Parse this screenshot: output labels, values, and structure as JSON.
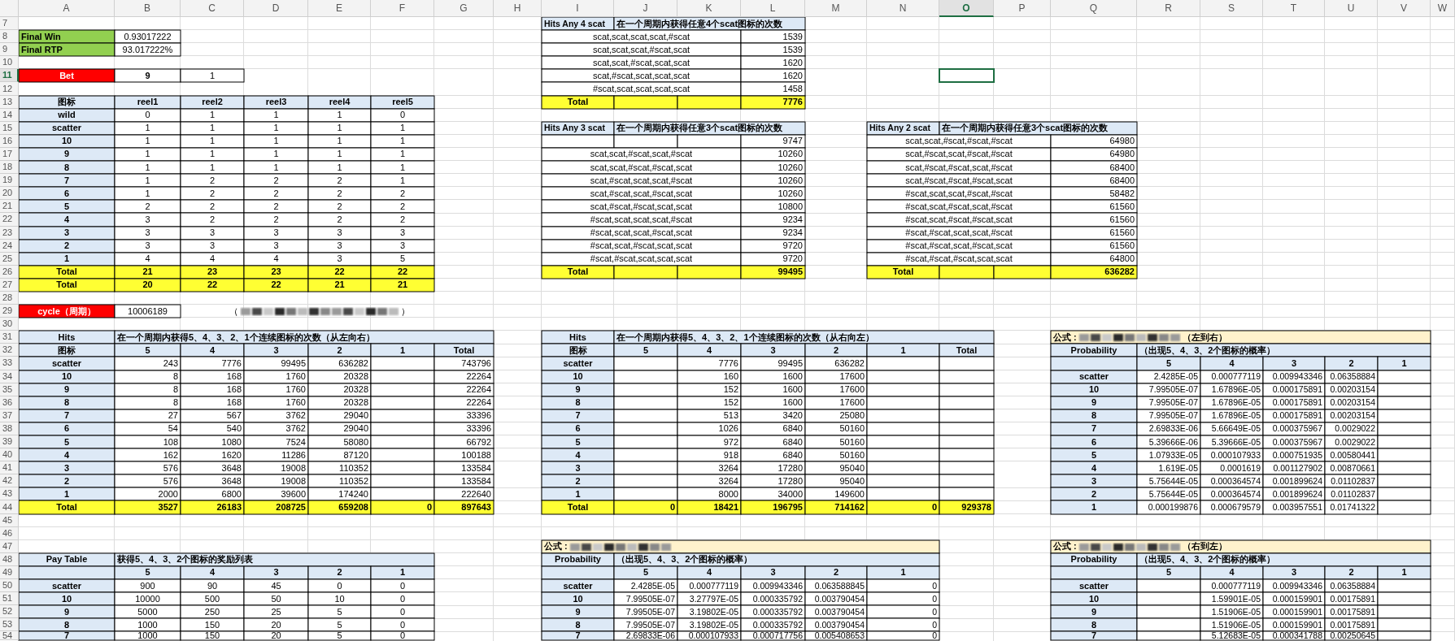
{
  "columns": [
    {
      "label": "A",
      "selected": false
    },
    {
      "label": "B",
      "selected": false
    },
    {
      "label": "C",
      "selected": false
    },
    {
      "label": "D",
      "selected": false
    },
    {
      "label": "E",
      "selected": false
    },
    {
      "label": "F",
      "selected": false
    },
    {
      "label": "G",
      "selected": false
    },
    {
      "label": "H",
      "selected": false
    },
    {
      "label": "I",
      "selected": false
    },
    {
      "label": "J",
      "selected": false
    },
    {
      "label": "K",
      "selected": false
    },
    {
      "label": "L",
      "selected": false
    },
    {
      "label": "M",
      "selected": false
    },
    {
      "label": "N",
      "selected": false
    },
    {
      "label": "O",
      "selected": true
    },
    {
      "label": "P",
      "selected": false
    },
    {
      "label": "Q",
      "selected": false
    },
    {
      "label": "R",
      "selected": false
    },
    {
      "label": "S",
      "selected": false
    },
    {
      "label": "T",
      "selected": false
    },
    {
      "label": "U",
      "selected": false
    },
    {
      "label": "V",
      "selected": false
    },
    {
      "label": "W",
      "selected": false
    }
  ],
  "rows": [
    {
      "label": "7",
      "selected": false
    },
    {
      "label": "8",
      "selected": false
    },
    {
      "label": "9",
      "selected": false
    },
    {
      "label": "10",
      "selected": false
    },
    {
      "label": "11",
      "selected": true
    },
    {
      "label": "12",
      "selected": false
    },
    {
      "label": "13",
      "selected": false
    },
    {
      "label": "14",
      "selected": false
    },
    {
      "label": "15",
      "selected": false
    },
    {
      "label": "16",
      "selected": false
    },
    {
      "label": "17",
      "selected": false
    },
    {
      "label": "18",
      "selected": false
    },
    {
      "label": "19",
      "selected": false
    },
    {
      "label": "20",
      "selected": false
    },
    {
      "label": "21",
      "selected": false
    },
    {
      "label": "22",
      "selected": false
    },
    {
      "label": "23",
      "selected": false
    },
    {
      "label": "24",
      "selected": false
    },
    {
      "label": "25",
      "selected": false
    },
    {
      "label": "26",
      "selected": false
    },
    {
      "label": "27",
      "selected": false
    },
    {
      "label": "28",
      "selected": false
    },
    {
      "label": "29",
      "selected": false
    },
    {
      "label": "30",
      "selected": false
    },
    {
      "label": "31",
      "selected": false
    },
    {
      "label": "32",
      "selected": false
    },
    {
      "label": "33",
      "selected": false
    },
    {
      "label": "34",
      "selected": false
    },
    {
      "label": "35",
      "selected": false
    },
    {
      "label": "36",
      "selected": false
    },
    {
      "label": "37",
      "selected": false
    },
    {
      "label": "38",
      "selected": false
    },
    {
      "label": "39",
      "selected": false
    },
    {
      "label": "40",
      "selected": false
    },
    {
      "label": "41",
      "selected": false
    },
    {
      "label": "42",
      "selected": false
    },
    {
      "label": "43",
      "selected": false
    },
    {
      "label": "44",
      "selected": false
    },
    {
      "label": "45",
      "selected": false
    },
    {
      "label": "46",
      "selected": false
    },
    {
      "label": "47",
      "selected": false
    },
    {
      "label": "48",
      "selected": false
    },
    {
      "label": "49",
      "selected": false
    },
    {
      "label": "50",
      "selected": false
    },
    {
      "label": "51",
      "selected": false
    },
    {
      "label": "52",
      "selected": false
    },
    {
      "label": "53",
      "selected": false
    },
    {
      "label": "54",
      "selected": false
    }
  ],
  "summary": [
    {
      "label": "Final Win",
      "value": "0.93017222"
    },
    {
      "label": "Final RTP",
      "value": "93.017222%"
    }
  ],
  "bet": {
    "label": "Bet",
    "values": [
      "9",
      "1"
    ]
  },
  "reel_table": {
    "header": [
      "图标",
      "reel1",
      "reel2",
      "reel3",
      "reel4",
      "reel5"
    ],
    "rows": [
      [
        "wild",
        "0",
        "1",
        "1",
        "1",
        "0"
      ],
      [
        "scatter",
        "1",
        "1",
        "1",
        "1",
        "1"
      ],
      [
        "10",
        "1",
        "1",
        "1",
        "1",
        "1"
      ],
      [
        "9",
        "1",
        "1",
        "1",
        "1",
        "1"
      ],
      [
        "8",
        "1",
        "1",
        "1",
        "1",
        "1"
      ],
      [
        "7",
        "1",
        "2",
        "2",
        "2",
        "1"
      ],
      [
        "6",
        "1",
        "2",
        "2",
        "2",
        "2"
      ],
      [
        "5",
        "2",
        "2",
        "2",
        "2",
        "2"
      ],
      [
        "4",
        "3",
        "2",
        "2",
        "2",
        "2"
      ],
      [
        "3",
        "3",
        "3",
        "3",
        "3",
        "3"
      ],
      [
        "2",
        "3",
        "3",
        "3",
        "3",
        "3"
      ],
      [
        "1",
        "4",
        "4",
        "4",
        "3",
        "5"
      ]
    ],
    "totals": [
      [
        "Total",
        "21",
        "23",
        "23",
        "22",
        "22"
      ],
      [
        "Total",
        "20",
        "22",
        "22",
        "21",
        "21"
      ]
    ]
  },
  "cycle": {
    "label": "cycle（周期）",
    "value": "10006189",
    "note_open": "（",
    "note_close": "）"
  },
  "hits_left_to_right": {
    "label": "Hits",
    "title": "在一个周期内获得5、4、3、2、1个连续图标的次数（从左向右）",
    "header": [
      "图标",
      "5",
      "4",
      "3",
      "2",
      "1",
      "Total"
    ],
    "rows": [
      [
        "scatter",
        "243",
        "7776",
        "99495",
        "636282",
        null,
        "743796"
      ],
      [
        "10",
        "8",
        "168",
        "1760",
        "20328",
        null,
        "22264"
      ],
      [
        "9",
        "8",
        "168",
        "1760",
        "20328",
        null,
        "22264"
      ],
      [
        "8",
        "8",
        "168",
        "1760",
        "20328",
        null,
        "22264"
      ],
      [
        "7",
        "27",
        "567",
        "3762",
        "29040",
        null,
        "33396"
      ],
      [
        "6",
        "54",
        "540",
        "3762",
        "29040",
        null,
        "33396"
      ],
      [
        "5",
        "108",
        "1080",
        "7524",
        "58080",
        null,
        "66792"
      ],
      [
        "4",
        "162",
        "1620",
        "11286",
        "87120",
        null,
        "100188"
      ],
      [
        "3",
        "576",
        "3648",
        "19008",
        "110352",
        null,
        "133584"
      ],
      [
        "2",
        "576",
        "3648",
        "19008",
        "110352",
        null,
        "133584"
      ],
      [
        "1",
        "2000",
        "6800",
        "39600",
        "174240",
        null,
        "222640"
      ]
    ],
    "total": [
      "Total",
      "3527",
      "26183",
      "208725",
      "659208",
      "0",
      "897643"
    ]
  },
  "pay_table": {
    "label": "Pay Table",
    "title": "获得5、4、3、2个图标的奖励列表",
    "header": [
      "5",
      "4",
      "3",
      "2",
      "1"
    ],
    "rows": [
      [
        "scatter",
        "900",
        "90",
        "45",
        "0",
        "0"
      ],
      [
        "10",
        "10000",
        "500",
        "50",
        "10",
        "0"
      ],
      [
        "9",
        "5000",
        "250",
        "25",
        "5",
        "0"
      ],
      [
        "8",
        "1000",
        "150",
        "20",
        "5",
        "0"
      ],
      [
        "7",
        "1000",
        "150",
        "20",
        "5",
        "0"
      ]
    ]
  },
  "hits_any_4": {
    "label": "Hits Any 4 scat",
    "title": "在一个周期内获得任意4个scat图标的次数",
    "rows": [
      {
        "combo": "scat,scat,scat,scat,#scat",
        "count": "1539"
      },
      {
        "combo": "scat,scat,scat,#scat,scat",
        "count": "1539"
      },
      {
        "combo": "scat,scat,#scat,scat,scat",
        "count": "1620"
      },
      {
        "combo": "scat,#scat,scat,scat,scat",
        "count": "1620"
      },
      {
        "combo": "#scat,scat,scat,scat,scat",
        "count": "1458"
      }
    ],
    "total": {
      "label": "Total",
      "count": "7776"
    }
  },
  "hits_any_3": {
    "label": "Hits Any 3 scat",
    "title": "在一个周期内获得任意3个scat图标的次数",
    "rows": [
      {
        "count": "9747"
      },
      {
        "combo": "scat,scat,#scat,scat,#scat",
        "count": "10260"
      },
      {
        "combo": "scat,scat,#scat,#scat,scat",
        "count": "10260"
      },
      {
        "combo": "scat,#scat,scat,scat,#scat",
        "count": "10260"
      },
      {
        "combo": "scat,#scat,scat,#scat,scat",
        "count": "10260"
      },
      {
        "combo": "scat,#scat,#scat,scat,scat",
        "count": "10800"
      },
      {
        "combo": "#scat,scat,scat,scat,#scat",
        "count": "9234"
      },
      {
        "combo": "#scat,scat,scat,#scat,scat",
        "count": "9234"
      },
      {
        "combo": "#scat,scat,#scat,scat,scat",
        "count": "9720"
      },
      {
        "combo": "#scat,#scat,scat,scat,scat",
        "count": "9720"
      }
    ],
    "total": {
      "label": "Total",
      "count": "99495"
    }
  },
  "hits_any_2": {
    "label": "Hits Any 2 scat",
    "title": "在一个周期内获得任意3个scat图标的次数",
    "rows": [
      {
        "combo": "scat,scat,#scat,#scat,#scat",
        "count": "64980"
      },
      {
        "combo": "scat,#scat,scat,#scat,#scat",
        "count": "64980"
      },
      {
        "combo": "scat,#scat,#scat,scat,#scat",
        "count": "68400"
      },
      {
        "combo": "scat,#scat,#scat,#scat,scat",
        "count": "68400"
      },
      {
        "combo": "#scat,scat,scat,#scat,#scat",
        "count": "58482"
      },
      {
        "combo": "#scat,scat,#scat,scat,#scat",
        "count": "61560"
      },
      {
        "combo": "#scat,scat,#scat,#scat,scat",
        "count": "61560"
      },
      {
        "combo": "#scat,#scat,scat,scat,#scat",
        "count": "61560"
      },
      {
        "combo": "#scat,#scat,scat,#scat,scat",
        "count": "61560"
      },
      {
        "combo": "#scat,#scat,#scat,scat,scat",
        "count": "64800"
      }
    ],
    "total": {
      "label": "Total",
      "count": "636282"
    }
  },
  "hits_right_to_left": {
    "label": "Hits",
    "title": "在一个周期内获得5、4、3、2、1个连续图标的次数（从右向左）",
    "header": [
      "图标",
      "5",
      "4",
      "3",
      "2",
      "1",
      "Total"
    ],
    "rows": [
      [
        "scatter",
        null,
        "7776",
        "99495",
        "636282",
        null,
        null
      ],
      [
        "10",
        null,
        "160",
        "1600",
        "17600",
        null,
        null
      ],
      [
        "9",
        null,
        "152",
        "1600",
        "17600",
        null,
        null
      ],
      [
        "8",
        null,
        "152",
        "1600",
        "17600",
        null,
        null
      ],
      [
        "7",
        null,
        "513",
        "3420",
        "25080",
        null,
        null
      ],
      [
        "6",
        null,
        "1026",
        "6840",
        "50160",
        null,
        null
      ],
      [
        "5",
        null,
        "972",
        "6840",
        "50160",
        null,
        null
      ],
      [
        "4",
        null,
        "918",
        "6840",
        "50160",
        null,
        null
      ],
      [
        "3",
        null,
        "3264",
        "17280",
        "95040",
        null,
        null
      ],
      [
        "2",
        null,
        "3264",
        "17280",
        "95040",
        null,
        null
      ],
      [
        "1",
        null,
        "8000",
        "34000",
        "149600",
        null,
        null
      ]
    ],
    "total": [
      "Total",
      "0",
      "18421",
      "196795",
      "714162",
      "0",
      "929378"
    ]
  },
  "probability_left_to_right": {
    "formula_label": "公式 :",
    "direction": "（左到右）",
    "label": "Probability",
    "title": "（出现5、4、3、2个图标的概率）",
    "header": [
      "5",
      "4",
      "3",
      "2",
      "1"
    ],
    "rows": [
      [
        "scatter",
        "2.4285E-05",
        "0.000777119",
        "0.009943346",
        "0.06358884",
        null
      ],
      [
        "10",
        "7.99505E-07",
        "1.67896E-05",
        "0.000175891",
        "0.00203154",
        null
      ],
      [
        "9",
        "7.99505E-07",
        "1.67896E-05",
        "0.000175891",
        "0.00203154",
        null
      ],
      [
        "8",
        "7.99505E-07",
        "1.67896E-05",
        "0.000175891",
        "0.00203154",
        null
      ],
      [
        "7",
        "2.69833E-06",
        "5.66649E-05",
        "0.000375967",
        "0.0029022",
        null
      ],
      [
        "6",
        "5.39666E-06",
        "5.39666E-05",
        "0.000375967",
        "0.0029022",
        null
      ],
      [
        "5",
        "1.07933E-05",
        "0.000107933",
        "0.000751935",
        "0.00580441",
        null
      ],
      [
        "4",
        "1.619E-05",
        "0.0001619",
        "0.001127902",
        "0.00870661",
        null
      ],
      [
        "3",
        "5.75644E-05",
        "0.000364574",
        "0.001899624",
        "0.01102837",
        null
      ],
      [
        "2",
        "5.75644E-05",
        "0.000364574",
        "0.001899624",
        "0.01102837",
        null
      ],
      [
        "1",
        "0.000199876",
        "0.000679579",
        "0.003957551",
        "0.01741322",
        null
      ]
    ]
  },
  "probability_middle": {
    "formula_label": "公式 :",
    "label": "Probability",
    "title": "（出现5、4、3、2个图标的概率）",
    "header": [
      "5",
      "4",
      "3",
      "2",
      "1"
    ],
    "rows": [
      [
        "scatter",
        "2.4285E-05",
        "0.000777119",
        "0.009943346",
        "0.063588845",
        "0"
      ],
      [
        "10",
        "7.99505E-07",
        "3.27797E-05",
        "0.000335792",
        "0.003790454",
        "0"
      ],
      [
        "9",
        "7.99505E-07",
        "3.19802E-05",
        "0.000335792",
        "0.003790454",
        "0"
      ],
      [
        "8",
        "7.99505E-07",
        "3.19802E-05",
        "0.000335792",
        "0.003790454",
        "0"
      ],
      [
        "7",
        "2.69833E-06",
        "0.000107933",
        "0.000717756",
        "0.005408653",
        "0"
      ]
    ]
  },
  "probability_right_to_left": {
    "formula_label": "公式 :",
    "direction": "（右到左）",
    "label": "Probability",
    "title": "（出现5、4、3、2个图标的概率）",
    "header": [
      "5",
      "4",
      "3",
      "2",
      "1"
    ],
    "rows": [
      [
        "scatter",
        null,
        "0.000777119",
        "0.009943346",
        "0.06358884",
        null
      ],
      [
        "10",
        null,
        "1.59901E-05",
        "0.000159901",
        "0.00175891",
        null
      ],
      [
        "9",
        null,
        "1.51906E-05",
        "0.000159901",
        "0.00175891",
        null
      ],
      [
        "8",
        null,
        "1.51906E-05",
        "0.000159901",
        "0.00175891",
        null
      ],
      [
        "7",
        null,
        "5.12683E-05",
        "0.000341788",
        "0.00250645",
        null
      ]
    ]
  }
}
